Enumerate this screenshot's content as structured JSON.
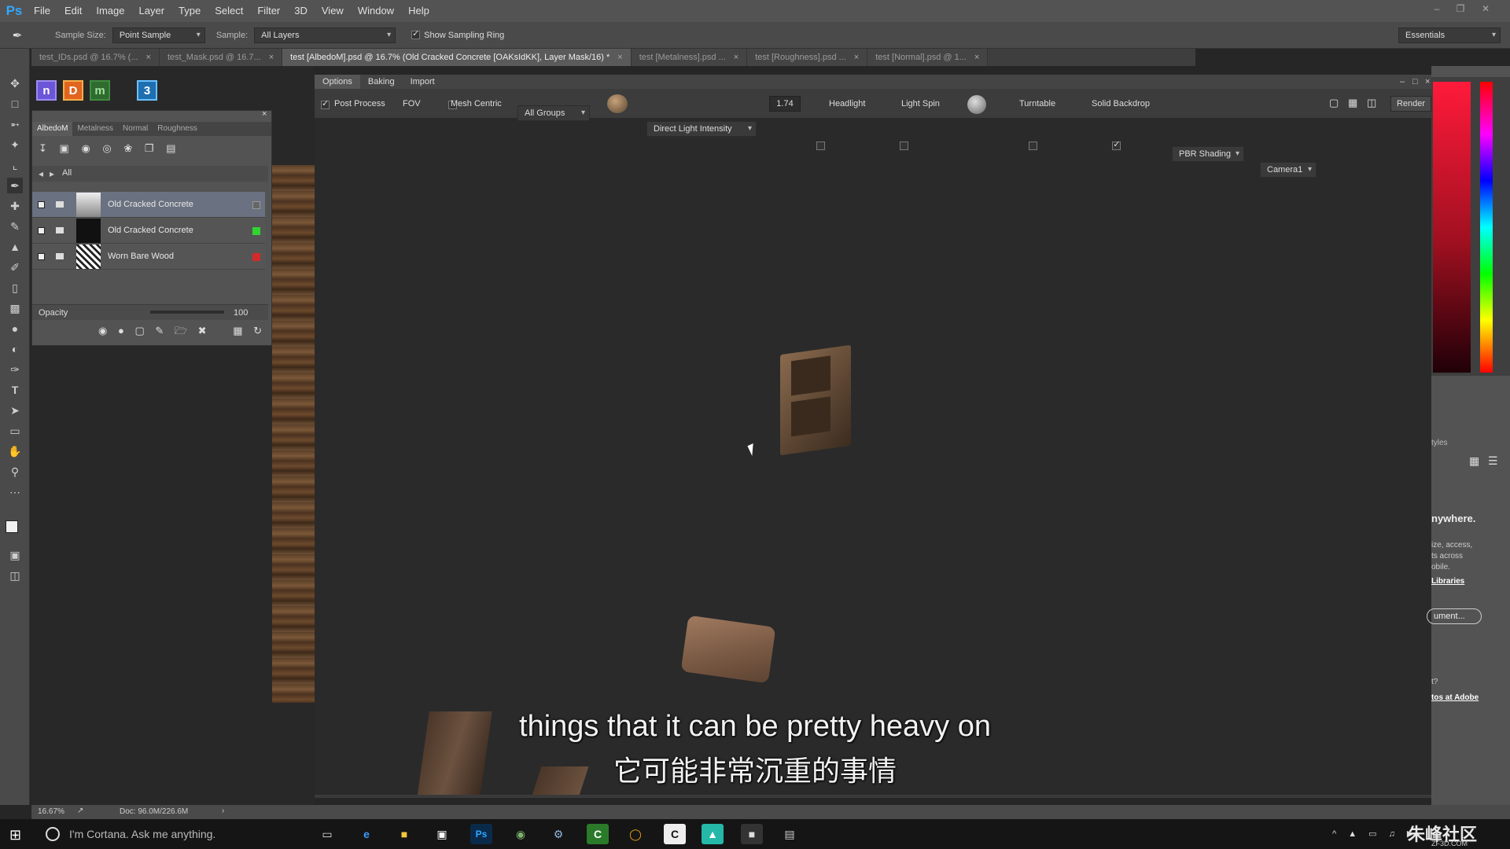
{
  "app": {
    "logo": "Ps",
    "menu": [
      "File",
      "Edit",
      "Image",
      "Layer",
      "Type",
      "Select",
      "Filter",
      "3D",
      "View",
      "Window",
      "Help"
    ]
  },
  "options_bar": {
    "sample_size_label": "Sample Size:",
    "sample_size_value": "Point Sample",
    "sample_label": "Sample:",
    "sample_value": "All Layers",
    "show_sampling_ring": "Show Sampling Ring",
    "workspace": "Essentials"
  },
  "doc_tabs": [
    {
      "label": "test_IDs.psd @ 16.7% (...",
      "active": false
    },
    {
      "label": "test_Mask.psd @ 16.7...",
      "active": false
    },
    {
      "label": "test [AlbedoM].psd @ 16.7% (Old Cracked Concrete [OAKsIdKK], Layer Mask/16) *",
      "active": true
    },
    {
      "label": "test [Metalness].psd ...",
      "active": false
    },
    {
      "label": "test [Roughness].psd ...",
      "active": false
    },
    {
      "label": "test [Normal].psd @ 1...",
      "active": false
    }
  ],
  "plugins": [
    {
      "letter": "n",
      "color": "#6b55d8"
    },
    {
      "letter": "D",
      "color": "#e2641e"
    },
    {
      "letter": "m",
      "color": "#3f8b3f"
    },
    {
      "letter": "3",
      "color": "#2b8fd8"
    }
  ],
  "layer_panel": {
    "tabs": [
      "AlbedoM",
      "Metalness",
      "Normal",
      "Roughness"
    ],
    "breadcrumb": "All",
    "layers": [
      {
        "name": "Old Cracked Concrete",
        "swatch": "#666666",
        "selected": true
      },
      {
        "name": "Old Cracked Concrete",
        "swatch": "#31d431",
        "selected": false
      },
      {
        "name": "Worn Bare Wood",
        "swatch": "#d42a2a",
        "selected": false
      }
    ],
    "opacity_label": "Opacity",
    "opacity_value": "100"
  },
  "viewport_tabs": [
    "Options",
    "Baking",
    "Import"
  ],
  "viewport_toolbar": {
    "post_process": "Post Process",
    "fov": "FOV",
    "mesh_centric": "Mesh Centric",
    "groups": "All Groups",
    "light_label": "Direct Light Intensity",
    "light_value": "1.74",
    "headlight": "Headlight",
    "light_spin": "Light Spin",
    "turntable": "Turntable",
    "solid_backdrop": "Solid Backdrop",
    "shading": "PBR Shading",
    "camera": "Camera1",
    "render": "Render"
  },
  "right_panel": {
    "tab_label": "tyles",
    "lines": [
      "nywhere.",
      "ize, access,",
      "ts across",
      "obile.",
      "Libraries",
      "ument...",
      "t?",
      "tos at Adobe"
    ]
  },
  "status": {
    "zoom": "16.67%",
    "doc": "Doc: 96.0M/226.6M"
  },
  "taskbar": {
    "search_placeholder": "I'm Cortana. Ask me anything.",
    "watermark": "朱峰社区",
    "watermark_sub": "ZF3D.COM"
  },
  "subtitles": {
    "en": "things that it can be pretty heavy on",
    "zh": "它可能非常沉重的事情"
  }
}
